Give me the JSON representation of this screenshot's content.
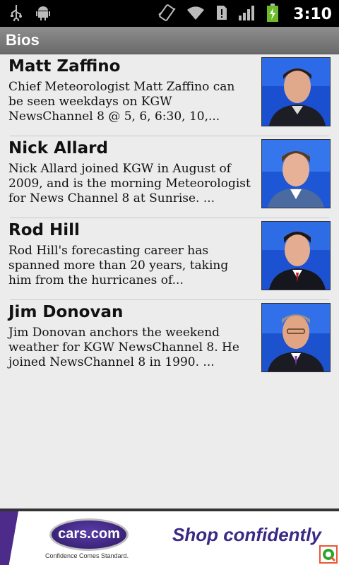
{
  "status_bar": {
    "time": "3:10",
    "icons": [
      "usb-icon",
      "android-debug-icon",
      "vibrate-icon",
      "wifi-icon",
      "alert-icon",
      "signal-icon",
      "battery-charging-icon"
    ]
  },
  "header": {
    "title": "Bios"
  },
  "bios": [
    {
      "name": "Matt Zaffino",
      "description": "Chief Meteorologist Matt Zaffino can be seen weekdays on KGW NewsChannel 8 @ 5, 6, 6:30, 10,..."
    },
    {
      "name": "Nick Allard",
      "description": "Nick Allard joined KGW in August of 2009, and is the morning Meteorologist for News Channel 8 at Sunrise.  ..."
    },
    {
      "name": "Rod Hill",
      "description": "Rod Hill's forecasting career has spanned more than 20 years, taking him from the hurricanes of..."
    },
    {
      "name": "Jim Donovan",
      "description": "Jim Donovan anchors the weekend weather for KGW NewsChannel 8. He joined NewsChannel 8 in 1990. ..."
    }
  ],
  "ad": {
    "logo_text": "cars.com",
    "tagline": "Confidence Comes Standard.",
    "slogan": "Shop confidently"
  },
  "colors": {
    "title_bar": "#7b7b7b",
    "background": "#ececec",
    "ad_brand": "#3b2a85"
  }
}
